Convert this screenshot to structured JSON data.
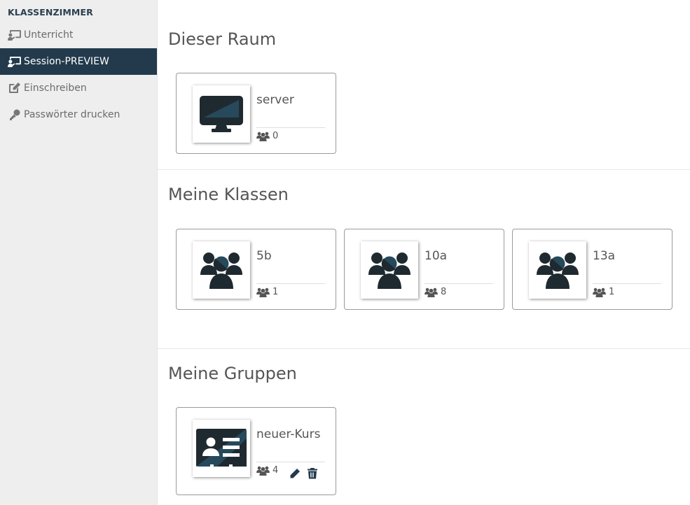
{
  "sidebar": {
    "heading": "KLASSENZIMMER",
    "items": [
      {
        "label": "Unterricht",
        "icon": "chalkboard-teacher-icon",
        "active": false
      },
      {
        "label": "Session-PREVIEW",
        "icon": "chalkboard-teacher-icon",
        "active": true
      },
      {
        "label": "Einschreiben",
        "icon": "edit-icon",
        "active": false
      },
      {
        "label": "Passwörter drucken",
        "icon": "key-icon",
        "active": false
      }
    ]
  },
  "sections": {
    "room": {
      "title": "Dieser Raum",
      "cards": [
        {
          "name": "server",
          "count": "0",
          "icon": "monitor-icon"
        }
      ]
    },
    "classes": {
      "title": "Meine Klassen",
      "cards": [
        {
          "name": "5b",
          "count": "1",
          "icon": "users-icon"
        },
        {
          "name": "10a",
          "count": "8",
          "icon": "users-icon"
        },
        {
          "name": "13a",
          "count": "1",
          "icon": "users-icon"
        }
      ]
    },
    "groups": {
      "title": "Meine Gruppen",
      "cards": [
        {
          "name": "neuer-Kurs",
          "count": "4",
          "icon": "id-card-icon"
        }
      ]
    }
  },
  "colors": {
    "sidebar_bg": "#eeeeee",
    "active_bg": "#223a4c",
    "icon_dark": "#1f2a30",
    "icon_accent": "#27495c"
  }
}
